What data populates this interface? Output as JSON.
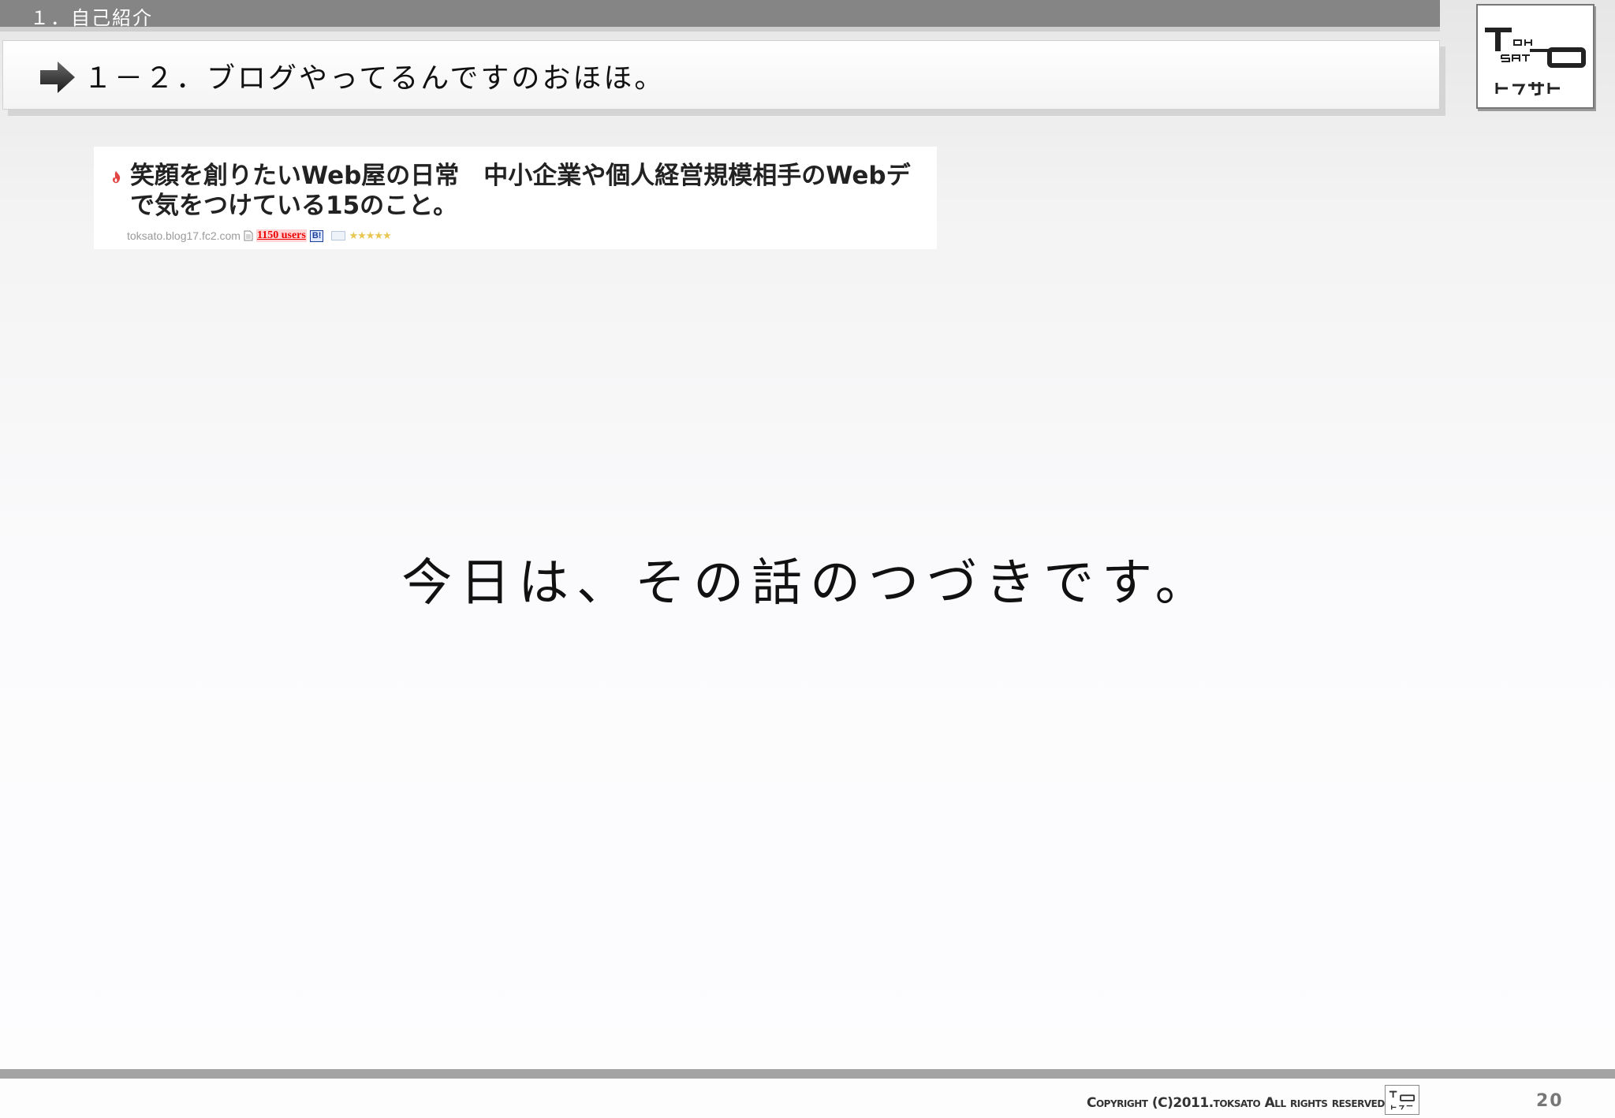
{
  "section": {
    "label": "１．自己紹介"
  },
  "subtitle": {
    "text": "１－２．ブログやってるんですのおほほ。"
  },
  "logo": {
    "alt_text": "TOH SATO",
    "caption": "トーウサト"
  },
  "blog_entry": {
    "title": "笑顔を創りたいWeb屋の日常　中小企業や個人経営規模相手のWebデ\nで気をつけている15のこと。",
    "domain": "toksato.blog17.fc2.com",
    "users": "1150 users",
    "bookmark_badge": "B!",
    "stars": "★★★★★"
  },
  "main": {
    "message": "今日は、その話のつづきです。"
  },
  "footer": {
    "copyright": "Copyright (C)2011.toksato All rights reserved.",
    "page_number": "20"
  },
  "colors": {
    "section_bar": "#858585",
    "accent_red": "#ee0000",
    "text": "#111111"
  },
  "icons": [
    "arrow-right-icon",
    "favicon-icon",
    "page-icon",
    "comment-icon",
    "logo-icon"
  ]
}
